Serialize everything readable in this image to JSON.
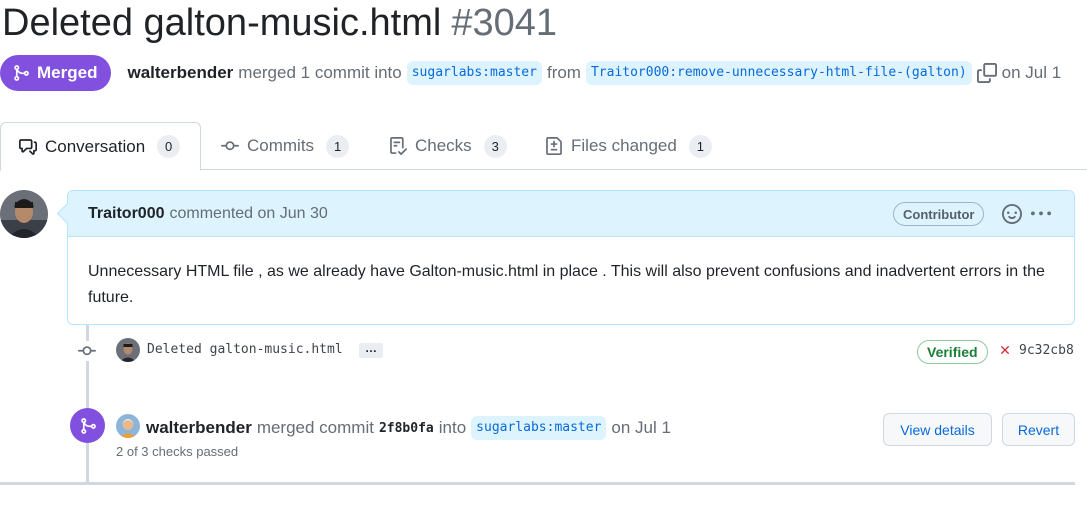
{
  "pr": {
    "title": "Deleted galton-music.html",
    "number": "#3041",
    "status": "Merged",
    "merger": "walterbender",
    "merged_text": "merged 1 commit into",
    "base_branch": "sugarlabs:master",
    "from_text": "from",
    "head_branch": "Traitor000:remove-unnecessary-html-file-(galton)",
    "date_text": "on Jul 1"
  },
  "tabs": [
    {
      "label": "Conversation",
      "count": "0",
      "icon": "comment-discussion-icon"
    },
    {
      "label": "Commits",
      "count": "1",
      "icon": "git-commit-icon"
    },
    {
      "label": "Checks",
      "count": "3",
      "icon": "checklist-icon"
    },
    {
      "label": "Files changed",
      "count": "1",
      "icon": "file-diff-icon"
    }
  ],
  "comment": {
    "author": "Traitor000",
    "meta": "commented on Jun 30",
    "badge": "Contributor",
    "body": "Unnecessary HTML file , as we already have Galton-music.html in place . This will also prevent confusions and inadvertent errors in the future."
  },
  "commit": {
    "message": "Deleted galton-music.html",
    "more": "…",
    "verified": "Verified",
    "sha": "9c32cb8"
  },
  "merge_event": {
    "author": "walterbender",
    "text1": "merged commit",
    "sha": "2f8b0fa",
    "text2": "into",
    "branch": "sugarlabs:master",
    "date": "on Jul 1",
    "checks": "2 of 3 checks passed",
    "view_details": "View details",
    "revert": "Revert"
  },
  "colors": {
    "merged_purple": "#8250df",
    "link_blue": "#0969da",
    "verified_green": "#1a7f37",
    "fail_red": "#cf222e"
  }
}
